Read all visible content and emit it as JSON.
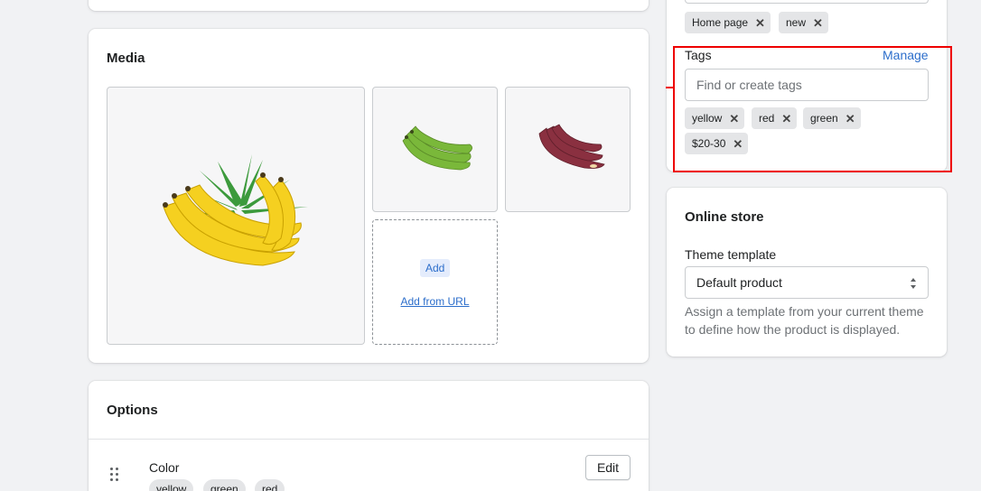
{
  "media": {
    "title": "Media",
    "add_label": "Add",
    "add_url_label": "Add from URL"
  },
  "organization": {
    "collections": [
      "Home page",
      "new"
    ],
    "tags_label": "Tags",
    "manage_label": "Manage",
    "tags_placeholder": "Find or create tags",
    "tags": [
      "yellow",
      "red",
      "green",
      "$20-30"
    ]
  },
  "online_store": {
    "title": "Online store",
    "theme_label": "Theme template",
    "theme_value": "Default product",
    "help_text_line1": "Assign a template from your current theme",
    "help_text_line2": "to define how the product is displayed."
  },
  "options": {
    "title": "Options",
    "option_name": "Color",
    "edit_label": "Edit",
    "values": [
      "yellow",
      "green",
      "red"
    ]
  },
  "colors": {
    "accent": "#2c6ecb",
    "highlight": "#ee0000",
    "page_bg": "#f1f2f4"
  },
  "icons": [
    "remove-tag-icon",
    "select-arrows-icon",
    "drag-handle-icon"
  ]
}
